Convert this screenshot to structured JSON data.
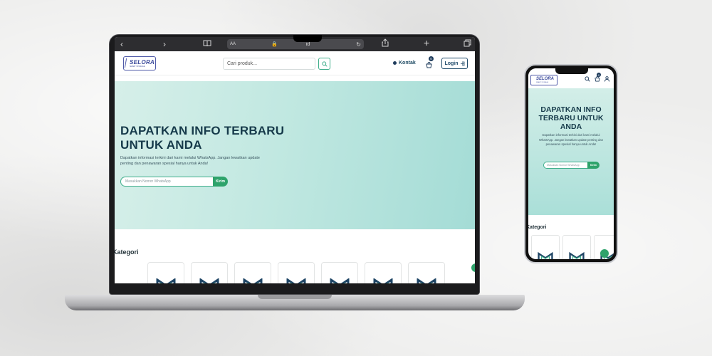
{
  "colors": {
    "brand_navy": "#1f3c5c",
    "brand_green": "#2ea36b",
    "hero_teal": "#a4dcd6",
    "logo_blue": "#3b4a9c"
  },
  "browser": {
    "text_size_label": "AA",
    "url_text": "id",
    "back_icon": "chevron-left-icon",
    "forward_icon": "chevron-right-icon",
    "bookmarks_icon": "book-icon",
    "lock_icon": "lock-icon",
    "reload_icon": "reload-icon",
    "share_icon": "share-icon",
    "new_tab_icon": "plus-icon",
    "tabs_icon": "tabs-icon"
  },
  "header": {
    "logo_text": "SELORA",
    "logo_subtext": "SMART STORAGE",
    "search_placeholder": "Cari produk...",
    "kontak_label": "Kontak",
    "cart_count": "0",
    "login_label": "Login"
  },
  "hero": {
    "title": "DAPATKAN INFO TERBARU UNTUK ANDA",
    "description": "Dapatkan informasi terkini dari kami melalui WhatsApp. Jangan lewatkan update penting dan penawaran spesial hanya untuk Anda!",
    "input_placeholder": "Masukkan Nomor WhatsApp",
    "submit_label": "Kirim"
  },
  "kategori": {
    "title": "Kategori",
    "card_count_laptop": 7,
    "card_count_phone": 3
  }
}
